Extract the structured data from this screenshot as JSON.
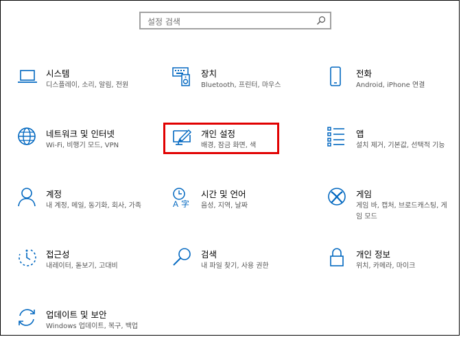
{
  "search": {
    "placeholder": "설정 검색",
    "icon": "search-icon"
  },
  "accent_color": "#0067c0",
  "highlight_color": "#e10000",
  "tiles": [
    {
      "title": "시스템",
      "desc": "디스플레이, 소리, 알림, 전원",
      "icon": "laptop-icon"
    },
    {
      "title": "장치",
      "desc": "Bluetooth, 프린터, 마우스",
      "icon": "keyboard-speaker-icon"
    },
    {
      "title": "전화",
      "desc": "Android, iPhone 연결",
      "icon": "phone-icon"
    },
    {
      "title": "네트워크 및 인터넷",
      "desc": "Wi-Fi, 비행기 모드, VPN",
      "icon": "globe-icon"
    },
    {
      "title": "개인 설정",
      "desc": "배경, 잠금 화면, 색",
      "icon": "paintbrush-monitor-icon"
    },
    {
      "title": "앱",
      "desc": "설치 제거, 기본값, 선택적 기능",
      "icon": "apps-list-icon"
    },
    {
      "title": "계정",
      "desc": "내 계정, 메일, 동기화, 회사, 가족",
      "icon": "person-icon"
    },
    {
      "title": "시간 및 언어",
      "desc": "음성, 지역, 날짜",
      "icon": "time-language-icon"
    },
    {
      "title": "게임",
      "desc": "게임 바, 캡처, 브로드캐스팅, 게임 모드",
      "icon": "xbox-icon"
    },
    {
      "title": "접근성",
      "desc": "내레이터, 돋보기, 고대비",
      "icon": "ease-of-access-icon"
    },
    {
      "title": "검색",
      "desc": "내 파일 찾기, 사용 권한",
      "icon": "search-magnifier-icon"
    },
    {
      "title": "개인 정보",
      "desc": "위치, 카메라, 마이크",
      "icon": "lock-icon"
    },
    {
      "title": "업데이트 및 보안",
      "desc": "Windows 업데이트, 복구, 백업",
      "icon": "sync-arrows-icon"
    }
  ]
}
